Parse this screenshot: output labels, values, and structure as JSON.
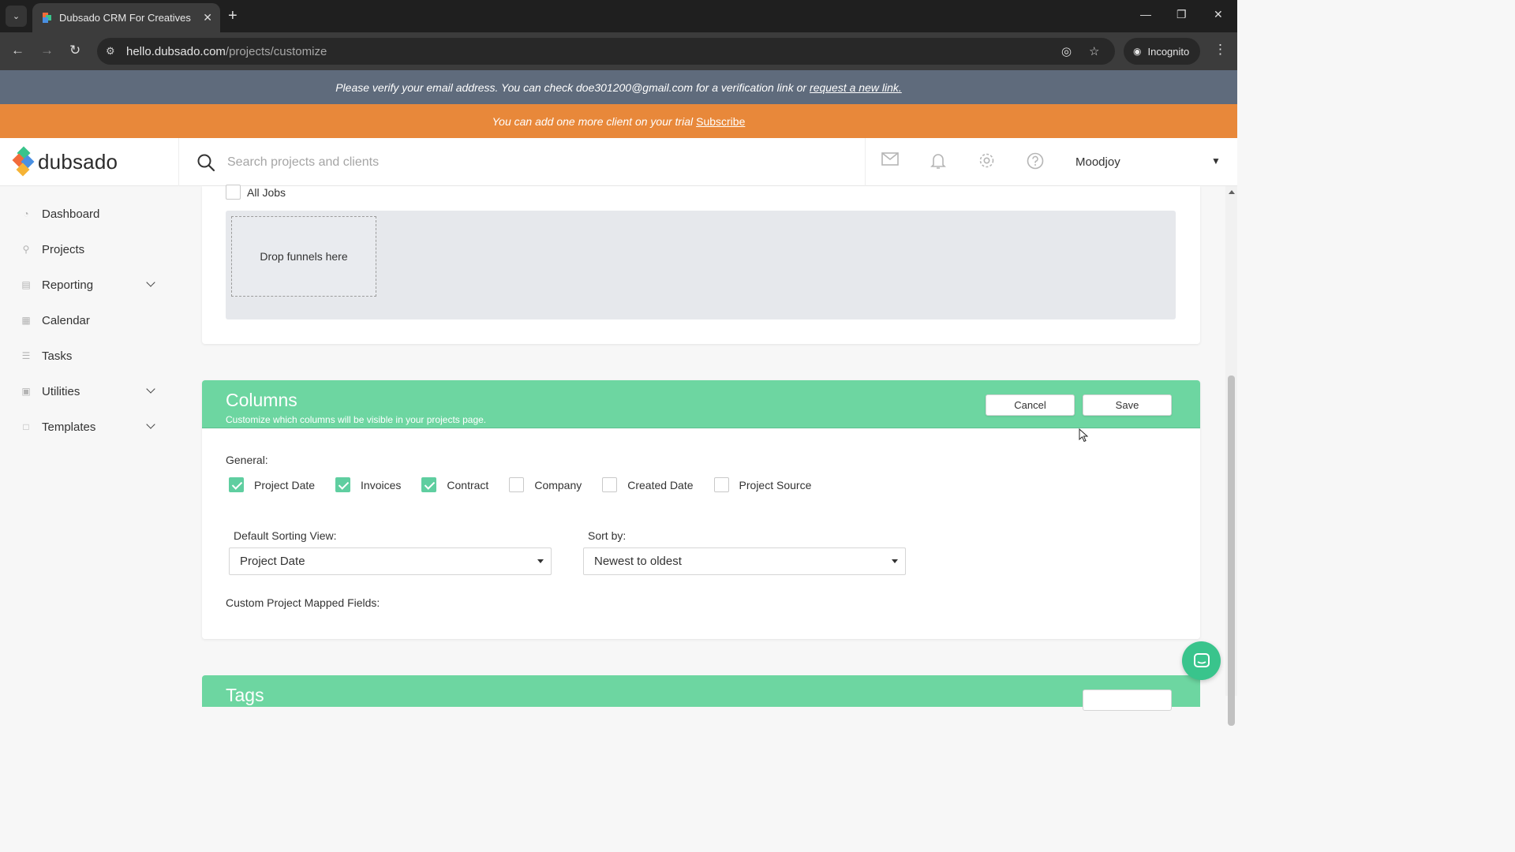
{
  "browser": {
    "tab_title": "Dubsado CRM For Creatives",
    "url_domain": "hello.dubsado.com",
    "url_path": "/projects/customize",
    "incognito_label": "Incognito"
  },
  "banners": {
    "verify_text": "Please verify your email address. You can check doe301200@gmail.com for a verification link or",
    "verify_link": "request a new link.",
    "trial_text": "You can add one more client on your trial",
    "trial_link": "Subscribe"
  },
  "header": {
    "logo_text": "dubsado",
    "search_placeholder": "Search projects and clients",
    "user_name": "Moodjoy"
  },
  "sidebar": {
    "items": [
      {
        "label": "Dashboard",
        "icon": "gauge-icon"
      },
      {
        "label": "Projects",
        "icon": "funnel-icon"
      },
      {
        "label": "Reporting",
        "icon": "chart-icon",
        "expandable": true
      },
      {
        "label": "Calendar",
        "icon": "calendar-icon"
      },
      {
        "label": "Tasks",
        "icon": "list-icon"
      },
      {
        "label": "Utilities",
        "icon": "toolbox-icon",
        "expandable": true
      },
      {
        "label": "Templates",
        "icon": "document-icon",
        "expandable": true
      }
    ]
  },
  "funnels": {
    "all_jobs_label": "All Jobs",
    "drop_text": "Drop funnels here"
  },
  "columns": {
    "title": "Columns",
    "subtitle": "Customize which columns will be visible in your projects page.",
    "cancel_label": "Cancel",
    "save_label": "Save",
    "general_label": "General:",
    "options": [
      {
        "label": "Project Date",
        "checked": true
      },
      {
        "label": "Invoices",
        "checked": true
      },
      {
        "label": "Contract",
        "checked": true
      },
      {
        "label": "Company",
        "checked": false
      },
      {
        "label": "Created Date",
        "checked": false
      },
      {
        "label": "Project Source",
        "checked": false
      }
    ],
    "default_sorting_label": "Default Sorting View:",
    "default_sorting_value": "Project Date",
    "sort_by_label": "Sort by:",
    "sort_by_value": "Newest to oldest",
    "custom_fields_label": "Custom Project Mapped Fields:"
  },
  "tags": {
    "title": "Tags"
  },
  "colors": {
    "accent_green": "#6dd6a1",
    "check_green": "#5fcea0",
    "trial_orange": "#e8883a",
    "verify_slate": "#5f6b7c"
  }
}
